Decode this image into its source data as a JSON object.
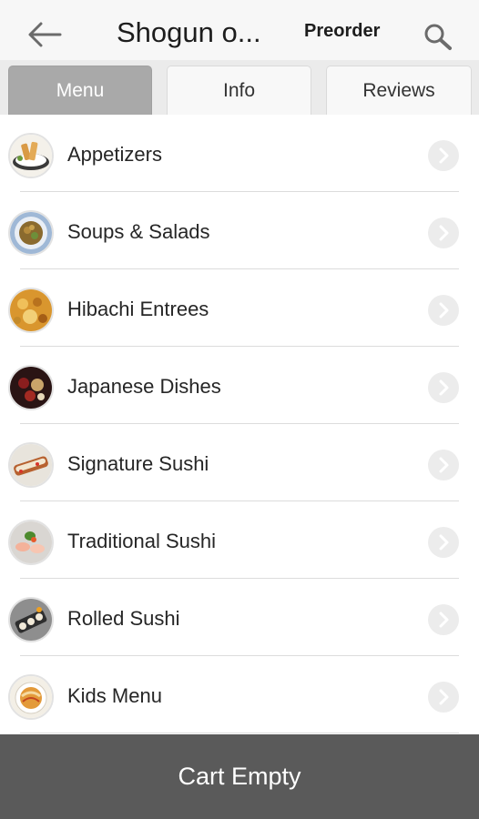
{
  "header": {
    "title": "Shogun o...",
    "preorder_label": "Preorder"
  },
  "tabs": [
    {
      "label": "Menu",
      "active": true
    },
    {
      "label": "Info",
      "active": false
    },
    {
      "label": "Reviews",
      "active": false
    }
  ],
  "categories": [
    {
      "label": "Appetizers",
      "thumb": "appetizer-dish-thumbnail"
    },
    {
      "label": "Soups & Salads",
      "thumb": "soup-salad-thumbnail"
    },
    {
      "label": "Hibachi Entrees",
      "thumb": "hibachi-thumbnail"
    },
    {
      "label": "Japanese Dishes",
      "thumb": "japanese-dish-thumbnail"
    },
    {
      "label": "Signature Sushi",
      "thumb": "signature-sushi-thumbnail"
    },
    {
      "label": "Traditional Sushi",
      "thumb": "traditional-sushi-thumbnail"
    },
    {
      "label": "Rolled Sushi",
      "thumb": "rolled-sushi-thumbnail"
    },
    {
      "label": "Kids Menu",
      "thumb": "kids-menu-thumbnail"
    }
  ],
  "cart": {
    "label": "Cart Empty"
  },
  "colors": {
    "header_bg": "#f7f7f7",
    "active_tab": "#a9a9a9",
    "cart_bar": "#5a5a5a"
  }
}
